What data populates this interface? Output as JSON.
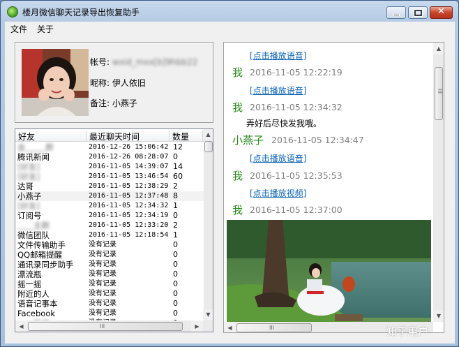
{
  "window": {
    "title": "楼月微信聊天记录导出恢复助手",
    "close_glyph": "✕"
  },
  "menu": [
    {
      "label": "文件"
    },
    {
      "label": "关于"
    }
  ],
  "profile": {
    "account_label": "帐号:",
    "account_value": "wxid_mxx[b]9hbb22",
    "nickname_label": "昵称:",
    "nickname_value": "伊人依旧",
    "remark_label": "备注:",
    "remark_value": "小燕子"
  },
  "friends": {
    "columns": [
      "好友",
      "最近聊天时间",
      "数量"
    ],
    "rows": [
      {
        "name": "金_____群",
        "time": "2016-12-26 15:06:42",
        "count": "12",
        "blur": true
      },
      {
        "name": "腾讯新闻",
        "time": "2016-12-26 08:28:07",
        "count": "0",
        "blur": false
      },
      {
        "name": "[好友]",
        "time": "2016-11-05 14:39:07",
        "count": "14",
        "blur": true
      },
      {
        "name": "[好友]",
        "time": "2016-11-05 13:46:54",
        "count": "60",
        "blur": true
      },
      {
        "name": "达哥",
        "time": "2016-11-05 12:38:29",
        "count": "2",
        "blur": false
      },
      {
        "name": "小燕子",
        "time": "2016-11-05 12:37:48",
        "count": "8",
        "blur": false,
        "selected": true
      },
      {
        "name": "[好友]",
        "time": "2016-11-05 12:34:32",
        "count": "1",
        "blur": true
      },
      {
        "name": "订阅号",
        "time": "2016-11-05 12:34:19",
        "count": "0",
        "blur": false
      },
      {
        "name": "____主群",
        "time": "2016-11-05 12:33:20",
        "count": "2",
        "blur": true
      },
      {
        "name": "微信团队",
        "time": "2016-11-05 12:18:54",
        "count": "1",
        "blur": false
      },
      {
        "name": "文件传输助手",
        "time": "没有记录",
        "count": "0",
        "blur": false
      },
      {
        "name": "QQ邮箱提醒",
        "time": "没有记录",
        "count": "0",
        "blur": false
      },
      {
        "name": "通讯录同步助手",
        "time": "没有记录",
        "count": "0",
        "blur": false
      },
      {
        "name": "漂流瓶",
        "time": "没有记录",
        "count": "0",
        "blur": false
      },
      {
        "name": "摇一摇",
        "time": "没有记录",
        "count": "0",
        "blur": false
      },
      {
        "name": "附近的人",
        "time": "没有记录",
        "count": "0",
        "blur": false
      },
      {
        "name": "语音记事本",
        "time": "没有记录",
        "count": "0",
        "blur": false
      },
      {
        "name": "Facebook",
        "time": "没有记录",
        "count": "0",
        "blur": false
      },
      {
        "name": "____助手",
        "time": "没有记录",
        "count": "0",
        "blur": true
      }
    ]
  },
  "chat": {
    "messages": [
      {
        "kind": "link",
        "text": "[点击播放语音]"
      },
      {
        "kind": "header",
        "sender": "我",
        "time": "2016-11-05 12:22:19",
        "me": true
      },
      {
        "kind": "link",
        "text": "[点击播放语音]"
      },
      {
        "kind": "header",
        "sender": "我",
        "time": "2016-11-05 12:34:32",
        "me": true
      },
      {
        "kind": "text",
        "text": "弄好后尽快发我哦。"
      },
      {
        "kind": "header",
        "sender": "小燕子",
        "time": "2016-11-05 12:34:47",
        "me": false
      },
      {
        "kind": "link",
        "text": "[点击播放语音]"
      },
      {
        "kind": "header",
        "sender": "我",
        "time": "2016-11-05 12:35:53",
        "me": true
      },
      {
        "kind": "link",
        "text": "[点击播放视频]"
      },
      {
        "kind": "header",
        "sender": "我",
        "time": "2016-11-05 12:37:00",
        "me": true
      }
    ]
  },
  "scroll_glyphs": {
    "up": "▲",
    "down": "▼",
    "left": "◀",
    "right": "▶",
    "grip": "III"
  },
  "watermark": "知乎用户",
  "colors": {
    "link": "#0c64b4",
    "sender": "#2a8a1e",
    "time": "#7f7f7f"
  }
}
